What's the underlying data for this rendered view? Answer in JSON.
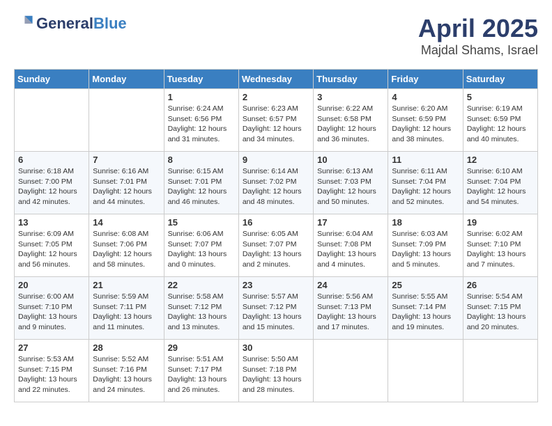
{
  "header": {
    "logo_general": "General",
    "logo_blue": "Blue",
    "month_title": "April 2025",
    "location": "Majdal Shams, Israel"
  },
  "days_of_week": [
    "Sunday",
    "Monday",
    "Tuesday",
    "Wednesday",
    "Thursday",
    "Friday",
    "Saturday"
  ],
  "weeks": [
    [
      {
        "day": "",
        "info": ""
      },
      {
        "day": "",
        "info": ""
      },
      {
        "day": "1",
        "info": "Sunrise: 6:24 AM\nSunset: 6:56 PM\nDaylight: 12 hours\nand 31 minutes."
      },
      {
        "day": "2",
        "info": "Sunrise: 6:23 AM\nSunset: 6:57 PM\nDaylight: 12 hours\nand 34 minutes."
      },
      {
        "day": "3",
        "info": "Sunrise: 6:22 AM\nSunset: 6:58 PM\nDaylight: 12 hours\nand 36 minutes."
      },
      {
        "day": "4",
        "info": "Sunrise: 6:20 AM\nSunset: 6:59 PM\nDaylight: 12 hours\nand 38 minutes."
      },
      {
        "day": "5",
        "info": "Sunrise: 6:19 AM\nSunset: 6:59 PM\nDaylight: 12 hours\nand 40 minutes."
      }
    ],
    [
      {
        "day": "6",
        "info": "Sunrise: 6:18 AM\nSunset: 7:00 PM\nDaylight: 12 hours\nand 42 minutes."
      },
      {
        "day": "7",
        "info": "Sunrise: 6:16 AM\nSunset: 7:01 PM\nDaylight: 12 hours\nand 44 minutes."
      },
      {
        "day": "8",
        "info": "Sunrise: 6:15 AM\nSunset: 7:01 PM\nDaylight: 12 hours\nand 46 minutes."
      },
      {
        "day": "9",
        "info": "Sunrise: 6:14 AM\nSunset: 7:02 PM\nDaylight: 12 hours\nand 48 minutes."
      },
      {
        "day": "10",
        "info": "Sunrise: 6:13 AM\nSunset: 7:03 PM\nDaylight: 12 hours\nand 50 minutes."
      },
      {
        "day": "11",
        "info": "Sunrise: 6:11 AM\nSunset: 7:04 PM\nDaylight: 12 hours\nand 52 minutes."
      },
      {
        "day": "12",
        "info": "Sunrise: 6:10 AM\nSunset: 7:04 PM\nDaylight: 12 hours\nand 54 minutes."
      }
    ],
    [
      {
        "day": "13",
        "info": "Sunrise: 6:09 AM\nSunset: 7:05 PM\nDaylight: 12 hours\nand 56 minutes."
      },
      {
        "day": "14",
        "info": "Sunrise: 6:08 AM\nSunset: 7:06 PM\nDaylight: 12 hours\nand 58 minutes."
      },
      {
        "day": "15",
        "info": "Sunrise: 6:06 AM\nSunset: 7:07 PM\nDaylight: 13 hours\nand 0 minutes."
      },
      {
        "day": "16",
        "info": "Sunrise: 6:05 AM\nSunset: 7:07 PM\nDaylight: 13 hours\nand 2 minutes."
      },
      {
        "day": "17",
        "info": "Sunrise: 6:04 AM\nSunset: 7:08 PM\nDaylight: 13 hours\nand 4 minutes."
      },
      {
        "day": "18",
        "info": "Sunrise: 6:03 AM\nSunset: 7:09 PM\nDaylight: 13 hours\nand 5 minutes."
      },
      {
        "day": "19",
        "info": "Sunrise: 6:02 AM\nSunset: 7:10 PM\nDaylight: 13 hours\nand 7 minutes."
      }
    ],
    [
      {
        "day": "20",
        "info": "Sunrise: 6:00 AM\nSunset: 7:10 PM\nDaylight: 13 hours\nand 9 minutes."
      },
      {
        "day": "21",
        "info": "Sunrise: 5:59 AM\nSunset: 7:11 PM\nDaylight: 13 hours\nand 11 minutes."
      },
      {
        "day": "22",
        "info": "Sunrise: 5:58 AM\nSunset: 7:12 PM\nDaylight: 13 hours\nand 13 minutes."
      },
      {
        "day": "23",
        "info": "Sunrise: 5:57 AM\nSunset: 7:12 PM\nDaylight: 13 hours\nand 15 minutes."
      },
      {
        "day": "24",
        "info": "Sunrise: 5:56 AM\nSunset: 7:13 PM\nDaylight: 13 hours\nand 17 minutes."
      },
      {
        "day": "25",
        "info": "Sunrise: 5:55 AM\nSunset: 7:14 PM\nDaylight: 13 hours\nand 19 minutes."
      },
      {
        "day": "26",
        "info": "Sunrise: 5:54 AM\nSunset: 7:15 PM\nDaylight: 13 hours\nand 20 minutes."
      }
    ],
    [
      {
        "day": "27",
        "info": "Sunrise: 5:53 AM\nSunset: 7:15 PM\nDaylight: 13 hours\nand 22 minutes."
      },
      {
        "day": "28",
        "info": "Sunrise: 5:52 AM\nSunset: 7:16 PM\nDaylight: 13 hours\nand 24 minutes."
      },
      {
        "day": "29",
        "info": "Sunrise: 5:51 AM\nSunset: 7:17 PM\nDaylight: 13 hours\nand 26 minutes."
      },
      {
        "day": "30",
        "info": "Sunrise: 5:50 AM\nSunset: 7:18 PM\nDaylight: 13 hours\nand 28 minutes."
      },
      {
        "day": "",
        "info": ""
      },
      {
        "day": "",
        "info": ""
      },
      {
        "day": "",
        "info": ""
      }
    ]
  ]
}
